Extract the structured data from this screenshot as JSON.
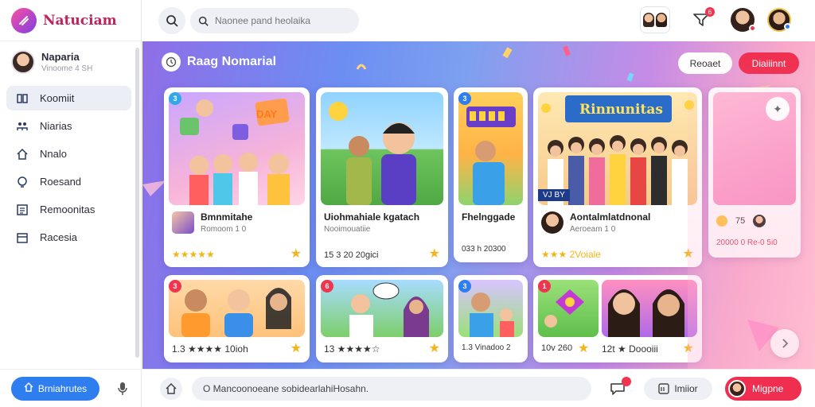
{
  "app": {
    "name": "Natuciam"
  },
  "user": {
    "name": "Naparia",
    "subtitle": "Vinoome 4 SH"
  },
  "sidebar": {
    "items": [
      {
        "label": "Koomiit",
        "icon": "book-icon",
        "active": true
      },
      {
        "label": "Niarias",
        "icon": "people-icon"
      },
      {
        "label": "Nnalo",
        "icon": "home-icon"
      },
      {
        "label": "Roesand",
        "icon": "bulb-icon"
      },
      {
        "label": "Remoonitas",
        "icon": "list-icon"
      },
      {
        "label": "Racesia",
        "icon": "calendar-icon"
      }
    ],
    "primary_button": "Brniahrutes"
  },
  "topbar": {
    "search_placeholder": "Naonee pand heolaika",
    "notification_count": "6"
  },
  "main": {
    "section_title": "Raag Nomarial",
    "recent_button": "Reoaet",
    "red_button": "Diaiiinnt",
    "cards_row1": [
      {
        "num": "3",
        "badge_text": "DAY",
        "title": "Bmnmitahe",
        "subtitle": "Romoom 1 0",
        "meta": "★★★★★"
      },
      {
        "title": "Uiohmahiale kgatach",
        "subtitle": "Nooimouatiie",
        "meta": "15 3 20 20gici"
      },
      {
        "num": "3",
        "title": "Fhelnggade",
        "meta": "033 h 20300"
      },
      {
        "banner": "Rinnunitas",
        "tag": "VJ BY",
        "title": "Aontalmlatdnonal",
        "subtitle": "Aeroeam 1 0",
        "meta": "★★★ 2Voiale"
      },
      {
        "meta": "20000 0 Re-0 5i0",
        "rating": "75"
      }
    ],
    "cards_row2": [
      {
        "num": "3",
        "meta": "1.3 ★★★★ 10ioh"
      },
      {
        "num": "6",
        "meta": "13 ★★★★☆"
      },
      {
        "num": "3",
        "meta": "1.3 Vinadoo 2"
      },
      {
        "num": "1",
        "meta": "10v 260"
      },
      {
        "meta": "12t ★ Doooiii"
      }
    ]
  },
  "bottombar": {
    "message_value": "O Mancoonoeane sobidearlahiHosahn.",
    "pill_label": "Imiior",
    "red_label": "Migpne"
  },
  "colors": {
    "accent_red": "#f02e4f",
    "primary_blue": "#2f7ef0",
    "star": "#f4b51c"
  }
}
